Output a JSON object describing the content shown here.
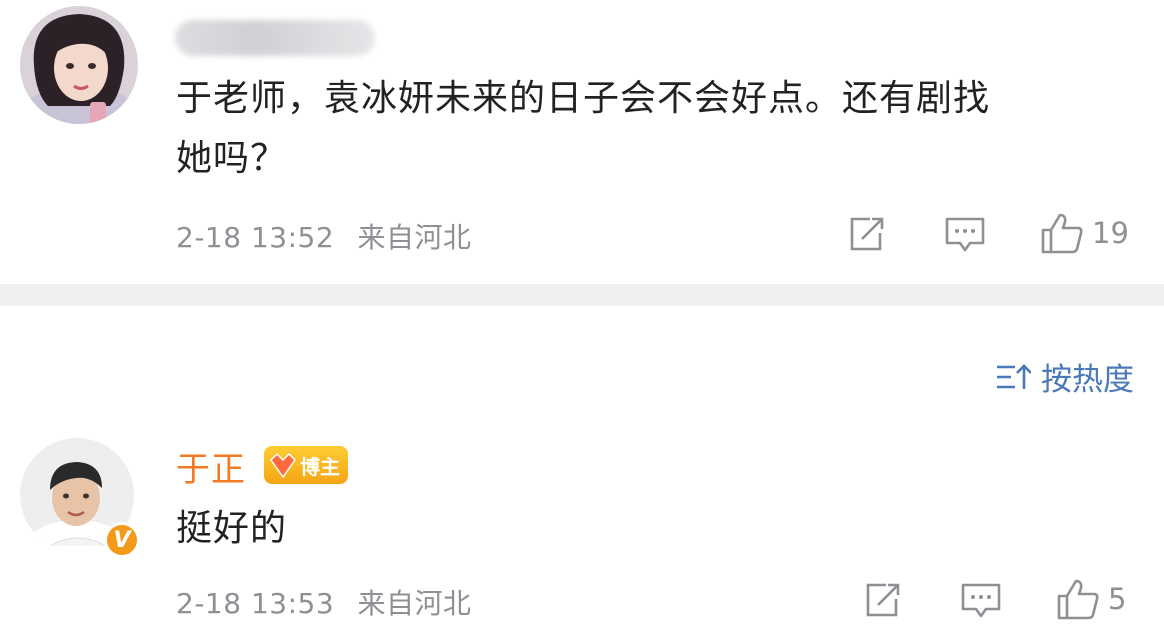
{
  "post": {
    "comment": "于老师，袁冰妍未来的日子会不会好点。还有剧找她吗？",
    "comment_line1": "于老师，袁冰妍未来的日子会不会好点。还有剧找",
    "comment_line2": "她吗？",
    "timestamp": "2-18 13:52",
    "location": "来自河北",
    "like_count": "19",
    "icons": {
      "share": "share-icon",
      "comment": "comment-icon",
      "like": "thumbs-up-icon"
    }
  },
  "sort": {
    "label": "按热度",
    "icon": "sort-icon"
  },
  "reply": {
    "username": "于正",
    "badge_label": "博主",
    "verified_mark": "V",
    "text": "挺好的",
    "timestamp": "2-18 13:53",
    "location": "来自河北",
    "like_count": "5"
  },
  "colors": {
    "username_orange": "#f17a22",
    "accent_blue": "#4a78b8",
    "meta_gray": "#8f8f95",
    "badge_gold": "#f5a515",
    "separator": "#f0f0f2"
  }
}
